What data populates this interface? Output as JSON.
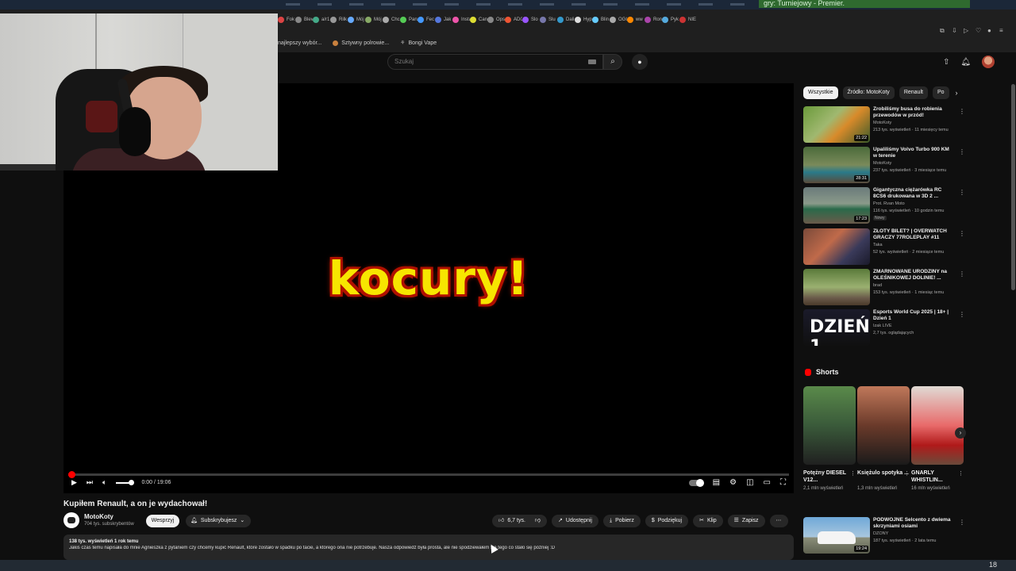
{
  "top": {
    "toast": "gry: Turniejowy - Premier."
  },
  "bookmarks": {
    "row1": [
      "Fok",
      "Blev",
      "a/r1",
      "Rilk",
      "Mój",
      "Mój",
      "Chc",
      "Paru",
      "Fec",
      "Jak",
      "Insta",
      "Can",
      "Ops",
      "ADC",
      "Slo",
      "Slu",
      "Dali",
      "Hyp",
      "Blin",
      "OGG",
      "ww",
      "Ron",
      "Pyk",
      "NIE"
    ],
    "row2": [
      "najlepszy wybór...",
      "Sztywny polrowie...",
      "Bongi Vape"
    ]
  },
  "header": {
    "search_placeholder": "Szukaj",
    "search_icon": "search-icon",
    "mic_icon": "mic-icon"
  },
  "player": {
    "overlay_text": "kocury!",
    "time": "0:00 / 19:06",
    "progress_fraction": 0.004
  },
  "video": {
    "title": "Kupiłem Renault, a on je wydachował!",
    "channel": "MotoKoty",
    "subs": "704 tys. subskrybentów",
    "join": "Wesprzyj",
    "subscribed": "Subskrybujesz",
    "likes": "6,7 tys.",
    "share": "Udostępnij",
    "download": "Pobierz",
    "thanks": "Podziękuj",
    "clip": "Klip",
    "save": "Zapisz",
    "desc_meta": "138 tys. wyświetleń  1 rok temu",
    "desc_text": "Jakiś czas temu napisała do mnie Agnieszka z pytaniem czy chcemy kupić Renault, które zostało w spadku po tacie, a którego ona nie potrzebuje. Nasza odpowiedź była prosta, ale nie spodziewałem się tego co stało się później :D"
  },
  "sidebar": {
    "chips": [
      "Wszystkie",
      "Źródło: MotoKoty",
      "Renault",
      "Po"
    ],
    "recs": [
      {
        "title": "Zrobiliśmy busa do robienia przewodów w przód!",
        "channel": "MotoKoty",
        "meta": "213 tys. wyświetleń · 11 miesięcy temu",
        "duration": "21:22",
        "badge": ""
      },
      {
        "title": "Upaliliśmy Volvo Turbo 900 KM w terenie",
        "channel": "MotoKoty",
        "meta": "237 tys. wyświetleń · 3 miesiące temu",
        "duration": "28:31",
        "badge": ""
      },
      {
        "title": "Gigantyczna ciężarówka RC 8CS6 drukowana w 3D 2 ...",
        "channel": "Prot. Rvan Moto",
        "meta": "116 tys. wyświetleń · 10 godzin temu",
        "duration": "17:23",
        "badge": "Nowy"
      },
      {
        "title": "ZŁOTY BILET? | OVERWATCH GRACZY 77ROLEPLAY #11",
        "channel": "Taka",
        "meta": "52 tys. wyświetleń · 2 miesiące temu",
        "duration": "",
        "badge": ""
      },
      {
        "title": "ZMARNOWANE URODZINY na OLEŚNIKOWEJ DOLINIE! ...",
        "channel": "brad",
        "meta": "153 tys. wyświetleń · 1 miesiąc temu",
        "duration": "",
        "badge": ""
      },
      {
        "title": "Esports World Cup 2025 | 18+ | Dzień 1",
        "channel": "Izak LIVE",
        "meta": "2,7 tys. oglądających",
        "duration": "",
        "badge": ""
      }
    ],
    "shorts_title": "Shorts",
    "shorts": [
      {
        "title": "Potężny DIESEL V12...",
        "views": "2,1 mln wyświetleń"
      },
      {
        "title": "Księżulo spotyka ...",
        "views": "1,3 mln wyświetleń"
      },
      {
        "title": "GNARLY WHISTLIN...",
        "views": "16 mln wyświetleń"
      }
    ],
    "bottom_rec": {
      "title": "PODWÓJNE Selcento z dwiema skrzyniami osiami",
      "channel": "DZONY",
      "meta": "187 tys. wyświetleń · 2 lata temu",
      "duration": "19:24"
    }
  },
  "taskbar": {
    "number": "18"
  },
  "colors": {
    "accent": "#ff0000",
    "overlay_fill": "#f7e600",
    "overlay_outline": "#b01000"
  }
}
